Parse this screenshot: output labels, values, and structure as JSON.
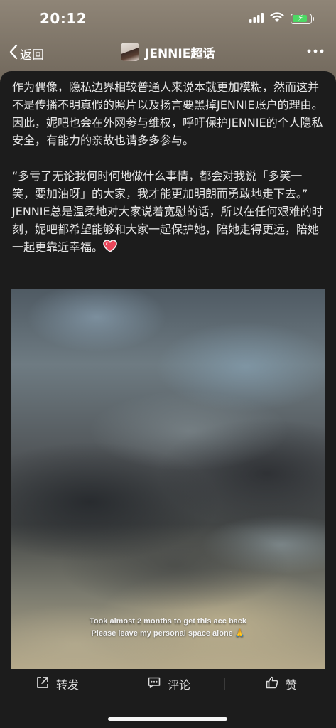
{
  "status_bar": {
    "time": "20:12",
    "battery_level": 0.85,
    "battery_charging": true,
    "icons": [
      "signal-icon",
      "wifi-icon",
      "battery-icon"
    ]
  },
  "nav": {
    "back_label": "返回",
    "title": "JENNIE超话",
    "icons": [
      "chevron-left-icon",
      "avatar",
      "more-icon"
    ]
  },
  "post": {
    "paragraph_1": "作为偶像，隐私边界相较普通人来说本就更加模糊，然而这并不是传播不明真假的照片以及扬言要黑掉JENNIE账户的理由。因此，妮吧也会在外网参与维权，呼吁保护JENNIE的个人隐私安全，有能力的亲故也请多多参与。",
    "paragraph_2": "“多亏了无论我何时何地做什么事情，都会对我说「多笑一笑，要加油呀」的大家，我才能更加明朗而勇敢地走下去。” JENNIE总是温柔地对大家说着宽慰的话，所以在任何艰难的时刻，妮吧都希望能够和大家一起保护她，陪她走得更远，陪她一起更靠近幸福。",
    "emoji": "heart-icon",
    "image": {
      "caption_line_1": "Took almost 2 months to get this acc back",
      "caption_line_2": "Please leave my personal space alone 🙏"
    }
  },
  "actions": {
    "share_label": "转发",
    "comment_label": "评论",
    "like_label": "赞"
  },
  "colors": {
    "card_background": "#1c1c1c",
    "text": "#e7e7e7",
    "battery_green": "#4cd964"
  }
}
